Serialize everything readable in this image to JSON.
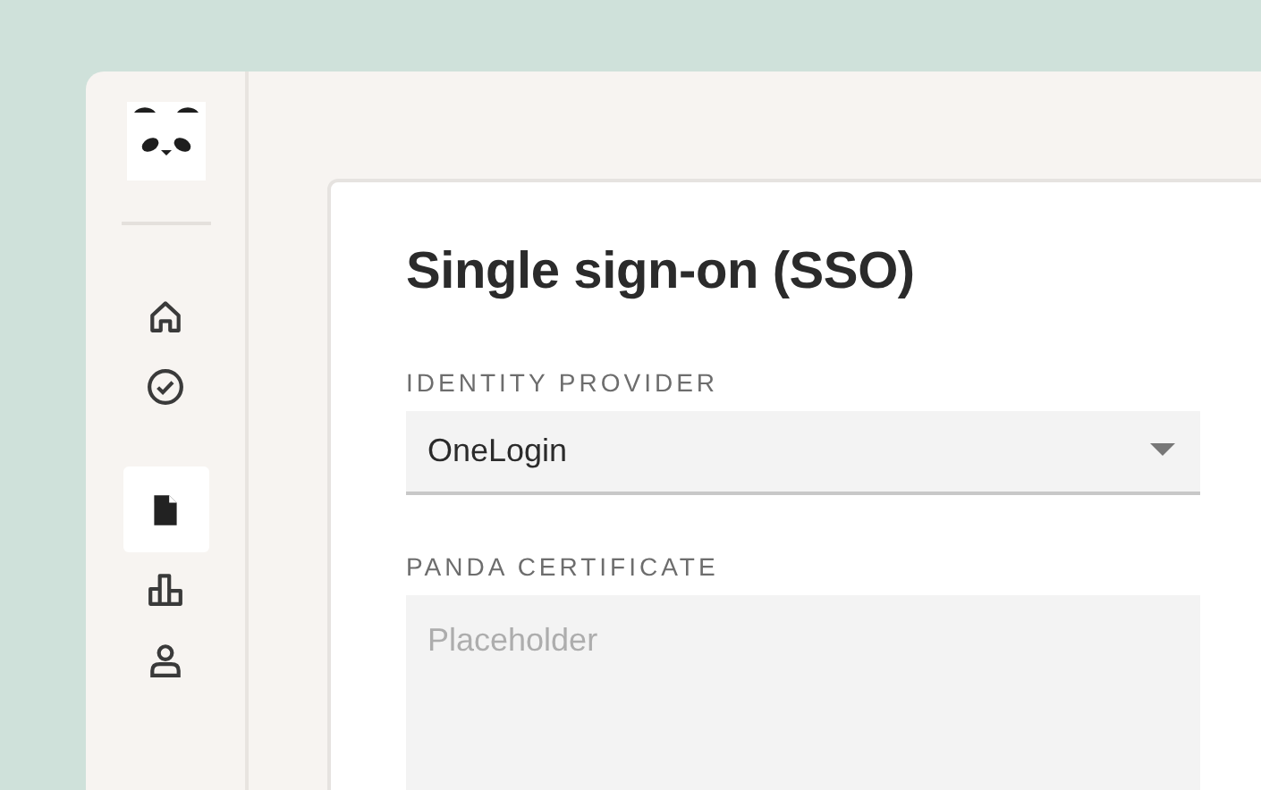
{
  "sidebar": {
    "items": [
      {
        "kind": "home",
        "selected": false
      },
      {
        "kind": "check",
        "selected": false
      },
      {
        "kind": "document",
        "selected": true
      },
      {
        "kind": "chart",
        "selected": false
      },
      {
        "kind": "user",
        "selected": false
      }
    ]
  },
  "form": {
    "title": "Single sign-on (SSO)",
    "fields": [
      {
        "kind": "select",
        "label": "IDENTITY PROVIDER",
        "value": "OneLogin"
      },
      {
        "kind": "textarea",
        "label": "PANDA CERTIFICATE",
        "placeholder": "Placeholder"
      }
    ]
  }
}
